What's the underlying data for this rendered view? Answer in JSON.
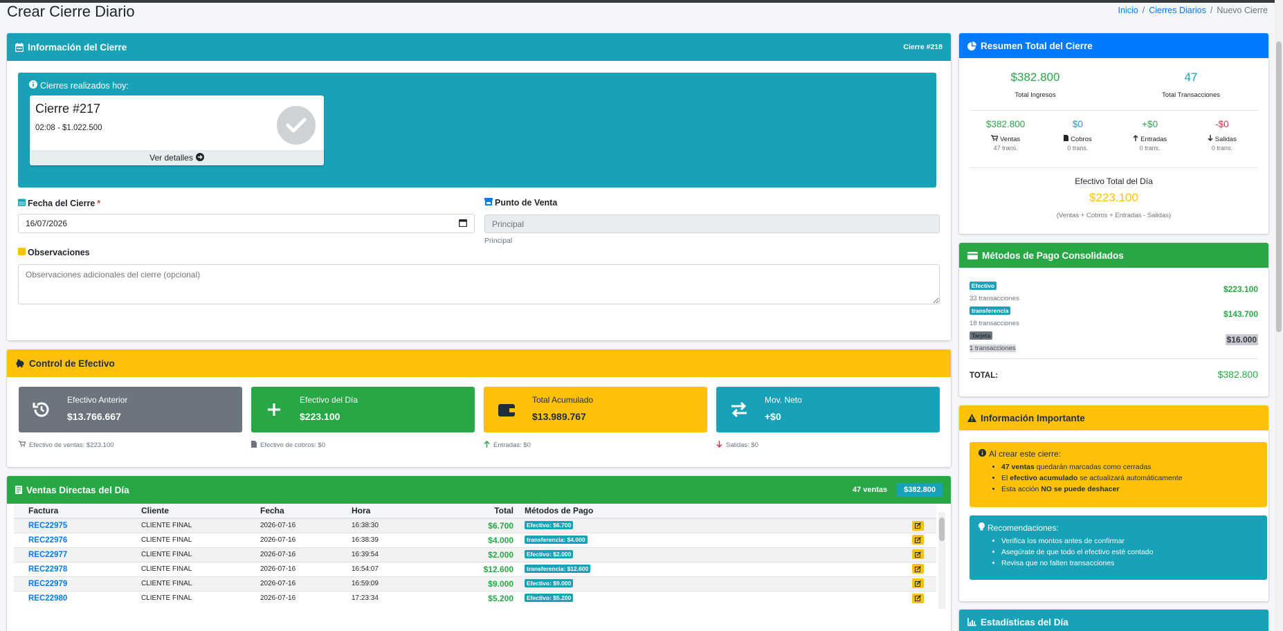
{
  "page": {
    "title": "Crear Cierre Diario"
  },
  "breadcrumb": {
    "items": [
      "Inicio",
      "Cierres Diarios",
      "Nuevo Cierre"
    ],
    "sep": "/"
  },
  "info": {
    "header": "Información del Cierre",
    "number": "Cierre #218",
    "today_title": "Cierres realizados hoy:",
    "prev": {
      "title": "Cierre #217",
      "sub": "02:08 - $1.022.500",
      "link": "Ver detalles"
    },
    "fecha_label": "Fecha del Cierre",
    "required": "*",
    "fecha_value": "16/07/2026",
    "pv_label": "Punto de Venta",
    "pv_value": "Principal",
    "pv_help": "Principal",
    "obs_label": "Observaciones",
    "obs_placeholder": "Observaciones adicionales del cierre (opcional)"
  },
  "control": {
    "header": "Control de Efectivo",
    "boxes": [
      {
        "label": "Efectivo Anterior",
        "value": "$13.766.667",
        "icon": "history-icon",
        "color": "#6c757d"
      },
      {
        "label": "Efectivo del Día",
        "value": "$223.100",
        "icon": "plus-icon",
        "color": "#28a745"
      },
      {
        "label": "Total Acumulado",
        "value": "$13.989.767",
        "icon": "wallet-icon",
        "color": "#ffc107"
      },
      {
        "label": "Mov. Neto",
        "value": "+$0",
        "icon": "exchange-icon",
        "color": "#17a2b8"
      }
    ],
    "notes": [
      "Efectivo de ventas: $223.100",
      "Efectivo de cobros: $0",
      "Entradas: $0",
      "Salidas: $0"
    ]
  },
  "ventas": {
    "header": "Ventas Directas del Día",
    "count": "47 ventas",
    "total": "$382.800",
    "columns": [
      "Factura",
      "Cliente",
      "Fecha",
      "Hora",
      "Total",
      "Métodos de Pago"
    ],
    "rows": [
      {
        "factura": "REC22975",
        "cliente": "CLIENTE FINAL",
        "fecha": "2026-07-16",
        "hora": "16:38:30",
        "total": "$6.700",
        "pago": "Efectivo: $6.700"
      },
      {
        "factura": "REC22976",
        "cliente": "CLIENTE FINAL",
        "fecha": "2026-07-16",
        "hora": "16:38:39",
        "total": "$4.000",
        "pago": "transferencia: $4.000"
      },
      {
        "factura": "REC22977",
        "cliente": "CLIENTE FINAL",
        "fecha": "2026-07-16",
        "hora": "16:39:54",
        "total": "$2.000",
        "pago": "Efectivo: $2.000"
      },
      {
        "factura": "REC22978",
        "cliente": "CLIENTE FINAL",
        "fecha": "2026-07-16",
        "hora": "16:54:07",
        "total": "$12.600",
        "pago": "transferencia: $12.600"
      },
      {
        "factura": "REC22979",
        "cliente": "CLIENTE FINAL",
        "fecha": "2026-07-16",
        "hora": "16:59:09",
        "total": "$9.000",
        "pago": "Efectivo: $9.000"
      },
      {
        "factura": "REC22980",
        "cliente": "CLIENTE FINAL",
        "fecha": "2026-07-16",
        "hora": "17:23:34",
        "total": "$5.200",
        "pago": "Efectivo: $5.200"
      }
    ]
  },
  "resumen": {
    "header": "Resumen Total del Cierre",
    "ingresos": "$382.800",
    "ingresos_label": "Total Ingresos",
    "trans": "47",
    "trans_label": "Total Transacciones",
    "cols": [
      {
        "value": "$382.800",
        "label": "Ventas",
        "sub": "47 trans.",
        "color": "#28a745"
      },
      {
        "value": "$0",
        "label": "Cobros",
        "sub": "0 trans.",
        "color": "#17a2b8"
      },
      {
        "value": "+$0",
        "label": "Entradas",
        "sub": "0 trans.",
        "color": "#28a745"
      },
      {
        "value": "-$0",
        "label": "Salidas",
        "sub": "0 trans.",
        "color": "#dc3545"
      }
    ],
    "efectivo_label": "Efectivo Total del Día",
    "efectivo_value": "$223.100",
    "formula": "(Ventas + Cobros + Entradas - Salidas)"
  },
  "metodos": {
    "header": "Métodos de Pago Consolidados",
    "items": [
      {
        "name": "Efectivo",
        "count": "33 transacciones",
        "value": "$223.100"
      },
      {
        "name": "transferencia",
        "count": "18 transacciones",
        "value": "$143.700"
      },
      {
        "name": "Tarjeta",
        "count": "1 transacciones",
        "value": "$16.000"
      }
    ],
    "total_label": "TOTAL:",
    "total_value": "$382.800"
  },
  "importante": {
    "header": "Información Importante",
    "al_crear": "Al crear este cierre:",
    "li1_b": "47 ventas",
    "li1_t": " quedarán marcadas como cerradas",
    "li2_a": "El ",
    "li2_b": "efectivo acumulado",
    "li2_t": " se actualizará automáticamente",
    "li3_a": "Esta acción ",
    "li3_b": "NO se puede deshacer",
    "rec_title": "Recomendaciones:",
    "recs": [
      "Verifica los montos antes de confirmar",
      "Asegúrate de que todo el efectivo esté contado",
      "Revisa que no falten transacciones"
    ]
  },
  "estadisticas": {
    "header": "Estadísticas del Día"
  }
}
